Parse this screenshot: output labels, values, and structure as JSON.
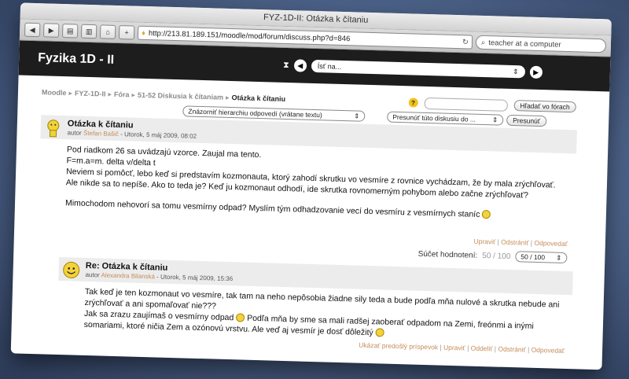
{
  "window": {
    "title": "FYZ-1D-II: Otázka k čítaniu"
  },
  "toolbar": {
    "url": "http://213.81.189.151/moodle/mod/forum/discuss.php?d=846",
    "search": "teacher at a computer"
  },
  "header": {
    "site_title": "Fyzika 1D - II",
    "jump_value": "Ísť na..."
  },
  "breadcrumb": {
    "items": [
      "Moodle",
      "FYZ-1D-II",
      "Fóra",
      "51-52 Diskusia k čítaniam"
    ],
    "current": "Otázka k čítaniu"
  },
  "forum_search": {
    "button": "Hľadať vo fórach"
  },
  "controls": {
    "display_mode": "Znázorniť hierarchiu odpovedí (vrátane textu)",
    "move_select": "Presunúť túto diskusiu do ...",
    "move_button": "Presunúť"
  },
  "post1": {
    "subject": "Otázka k čítaniu",
    "meta_prefix": "autor",
    "author": "Štefan Bašič",
    "meta_date": "- Utorok, 5 máj 2009, 08:02",
    "lines": [
      "Pod riadkom 26 sa uvádzajú vzorce. Zaujal ma tento.",
      "F=m.a=m. delta v/delta t",
      "Neviem si pomôcť, lebo keď si predstavím kozmonauta, ktorý zahodí skrutku vo vesmíre z rovnice vychádzam, že by mala zrýchľovať. Ale nikde sa to nepíše. Ako to teda je? Keď ju kozmonaut odhodí, ide skrutka rovnomerným pohybom alebo začne zrýchľovať?",
      "",
      "Mimochodom nehovorí sa tomu vesmírny odpad? Myslím tým odhadzovanie vecí do vesmíru z vesmírnych staníc"
    ],
    "actions": [
      "Upraviť",
      "Odstrániť",
      "Odpovedať"
    ],
    "rating_label": "Súčet hodnotení:",
    "rating_value": "50 / 100",
    "rating_select": "50 / 100"
  },
  "post2": {
    "subject": "Re: Otázka k čítaniu",
    "meta_prefix": "autor",
    "author": "Alexandra Bilanská",
    "meta_date": "- Utorok, 5 máj 2009, 15:36",
    "lines": [
      "Tak keď je ten kozmonaut vo vesmíre, tak tam na neho nepôsobia žiadne sily teda a bude podľa mňa nulové a skrutka nebude ani zrýchľovať a ani spomaľovať nie???",
      "Jak sa zrazu zaujímaš o vesmírny odpad",
      "Podľa mňa by sme sa mali radšej zaoberať odpadom na Zemi, freónmi a inými somariami, ktoré ničia Zem a ozónovú vrstvu. Ale veď aj vesmír je dosť dôležitý"
    ],
    "actions": [
      "Ukázať predošlý príspevok",
      "Upraviť",
      "Oddeliť",
      "Odstrániť",
      "Odpovedať"
    ]
  },
  "colors": {
    "header_bg": "#1d1d1d",
    "link": "#c58c5a"
  }
}
